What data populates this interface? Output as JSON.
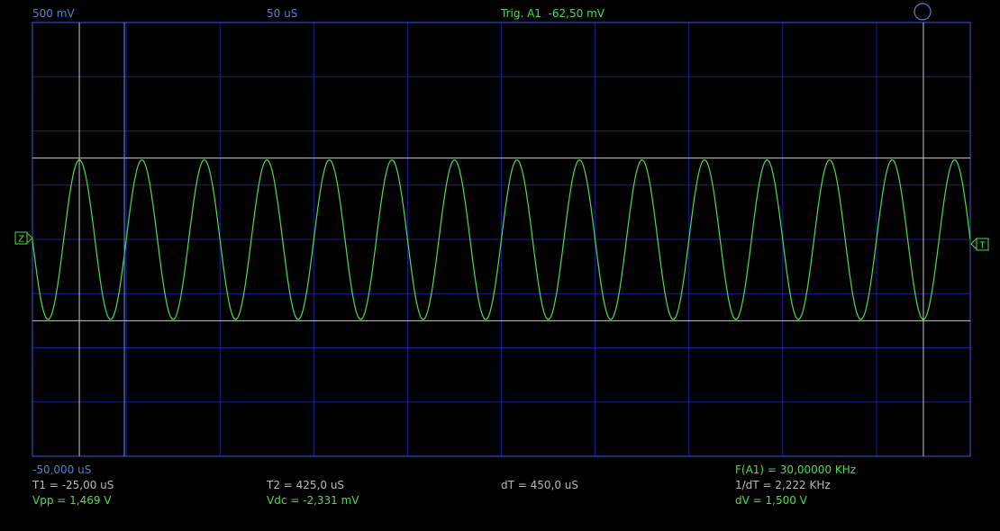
{
  "header": {
    "volts_per_div": "500 mV",
    "time_per_div": "50 uS",
    "trigger_label": "Trig. A1",
    "trigger_level": "-62,50 mV"
  },
  "markers": {
    "zero_marker": "Z",
    "trigger_marker": "T"
  },
  "readouts": {
    "time_offset": "-50,000 uS",
    "t1": "T1 = -25,00 uS",
    "t2": "T2 = 425,0 uS",
    "dt": "dT = 450,0 uS",
    "inv_dt": "1/dT = 2,222 KHz",
    "frequency": "F(A1) = 30,00000 KHz",
    "vpp": "Vpp = 1,469 V",
    "vdc": "Vdc = -2,331 mV",
    "dv": "dV = 1,500 V"
  },
  "colors": {
    "background": "#000000",
    "grid": "#1c1c9a",
    "border": "#3a5ad8",
    "trace": "#46e04a",
    "cursor": "#c8c8c8",
    "cursor_t1": "#5a9ae0",
    "label_blue": "#4f84d4",
    "label_green": "#46e04a"
  },
  "chart_data": {
    "type": "line",
    "xlabel": "",
    "ylabel": "",
    "xlim": [
      -50,
      450
    ],
    "ylim": [
      -2000,
      2000
    ],
    "x_unit": "uS",
    "y_unit": "mV",
    "grid": true,
    "series": [
      {
        "signal": "sine",
        "frequency_khz": 30,
        "amplitude_mv": 735,
        "offset_mv": -2.331
      }
    ],
    "cursors": {
      "t1_us": -25,
      "t2_us": 425,
      "v_upper_mv": 750,
      "v_lower_mv": -750
    }
  }
}
